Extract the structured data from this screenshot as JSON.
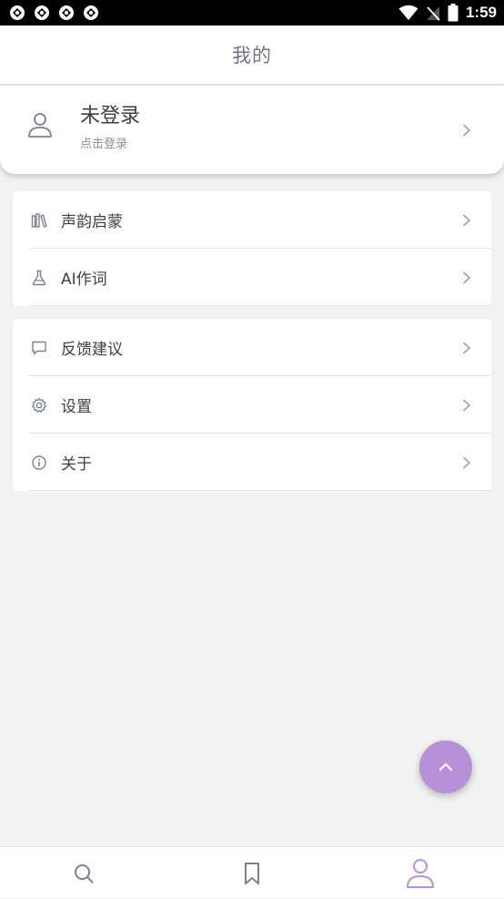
{
  "status_bar": {
    "time": "1:59",
    "notification_icons": [
      "app-notification-icon",
      "app-notification-icon",
      "app-notification-icon",
      "app-notification-icon"
    ],
    "system_icons": [
      "wifi-icon",
      "no-signal-icon",
      "battery-icon"
    ]
  },
  "header": {
    "title": "我的"
  },
  "profile": {
    "name": "未登录",
    "subtitle": "点击登录",
    "icon": "user-icon"
  },
  "menu_groups": [
    {
      "items": [
        {
          "label": "声韵启蒙",
          "icon": "books-icon"
        },
        {
          "label": "AI作词",
          "icon": "flask-icon"
        }
      ]
    },
    {
      "items": [
        {
          "label": "反馈建议",
          "icon": "message-icon"
        },
        {
          "label": "设置",
          "icon": "gear-icon"
        },
        {
          "label": "关于",
          "icon": "info-icon"
        }
      ]
    }
  ],
  "fab": {
    "icon": "chevron-up-icon"
  },
  "tabbar": {
    "tabs": [
      {
        "icon": "search-icon",
        "active": false
      },
      {
        "icon": "bookmark-icon",
        "active": false
      },
      {
        "icon": "user-icon",
        "active": true
      }
    ]
  },
  "colors": {
    "accent": "#b691d9",
    "text_primary": "#3b3f4a",
    "text_secondary": "#8a8f99",
    "icon_muted": "#7a8290",
    "background": "#f2f2f2"
  }
}
